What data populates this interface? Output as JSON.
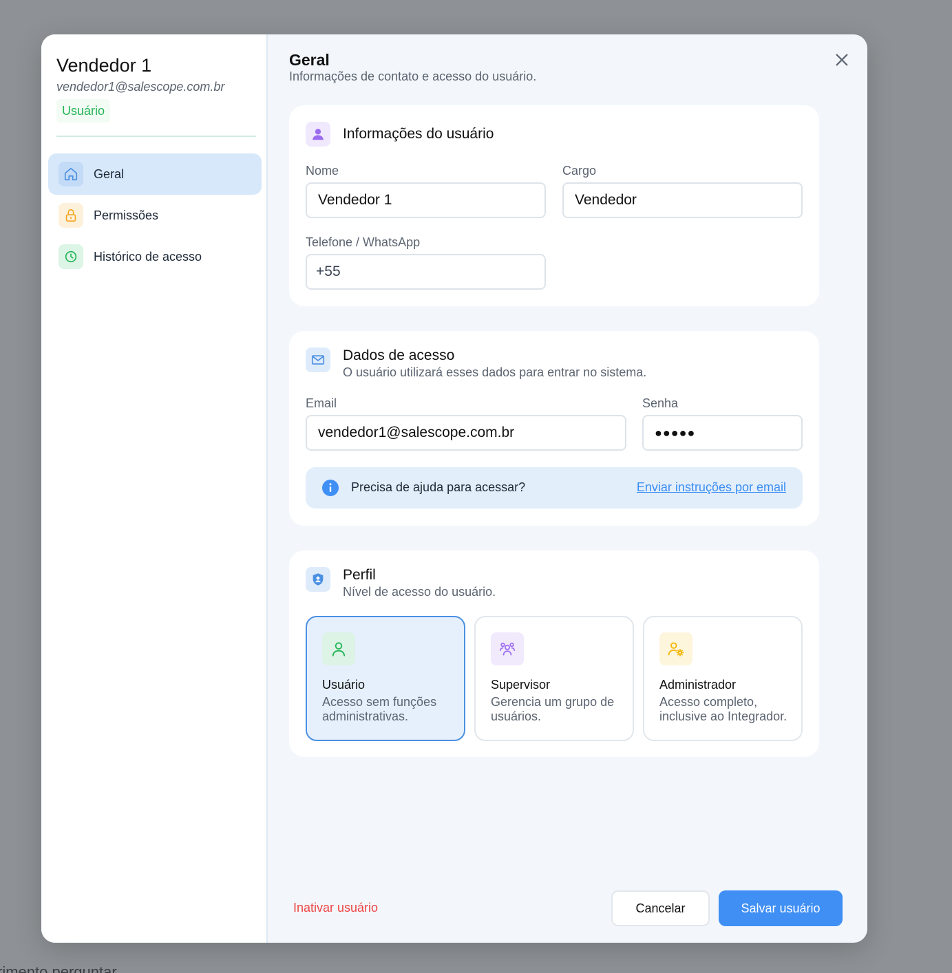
{
  "backdrop": {
    "text": "rimento perguntar"
  },
  "sidebar": {
    "user_name": "Vendedor 1",
    "user_email": "vendedor1@salescope.com.br",
    "role_badge": "Usuário",
    "items": [
      {
        "label": "Geral",
        "icon": "home-icon",
        "active": true
      },
      {
        "label": "Permissões",
        "icon": "lock-icon",
        "active": false
      },
      {
        "label": "Histórico de acesso",
        "icon": "clock-icon",
        "active": false
      }
    ]
  },
  "header": {
    "title": "Geral",
    "subtitle": "Informações de contato e acesso do usuário."
  },
  "user_info": {
    "title": "Informações do usuário",
    "name_label": "Nome",
    "name_value": "Vendedor 1",
    "position_label": "Cargo",
    "position_value": "Vendedor",
    "phone_label": "Telefone / WhatsApp",
    "phone_value": "+55"
  },
  "access": {
    "title": "Dados de acesso",
    "subtitle": "O usuário utilizará esses dados para entrar no sistema.",
    "email_label": "Email",
    "email_value": "vendedor1@salescope.com.br",
    "password_label": "Senha",
    "password_value": "●●●●●",
    "help_text": "Precisa de ajuda para acessar?",
    "help_link": "Enviar instruções por email"
  },
  "profile": {
    "title": "Perfil",
    "subtitle": "Nível de acesso do usuário.",
    "options": [
      {
        "title": "Usuário",
        "desc": "Acesso sem funções administrativas.",
        "icon": "user-icon",
        "selected": true
      },
      {
        "title": "Supervisor",
        "desc": "Gerencia um grupo de usuários.",
        "icon": "users-group-icon",
        "selected": false
      },
      {
        "title": "Administrador",
        "desc": "Acesso completo, inclusive ao Integrador.",
        "icon": "user-gear-icon",
        "selected": false
      }
    ]
  },
  "footer": {
    "inactivate_label": "Inativar usuário",
    "cancel_label": "Cancelar",
    "save_label": "Salvar usuário"
  },
  "colors": {
    "accent": "#3f8ff5",
    "danger": "#ef4444",
    "success": "#22b455",
    "active_nav": "#d7e8fb"
  }
}
